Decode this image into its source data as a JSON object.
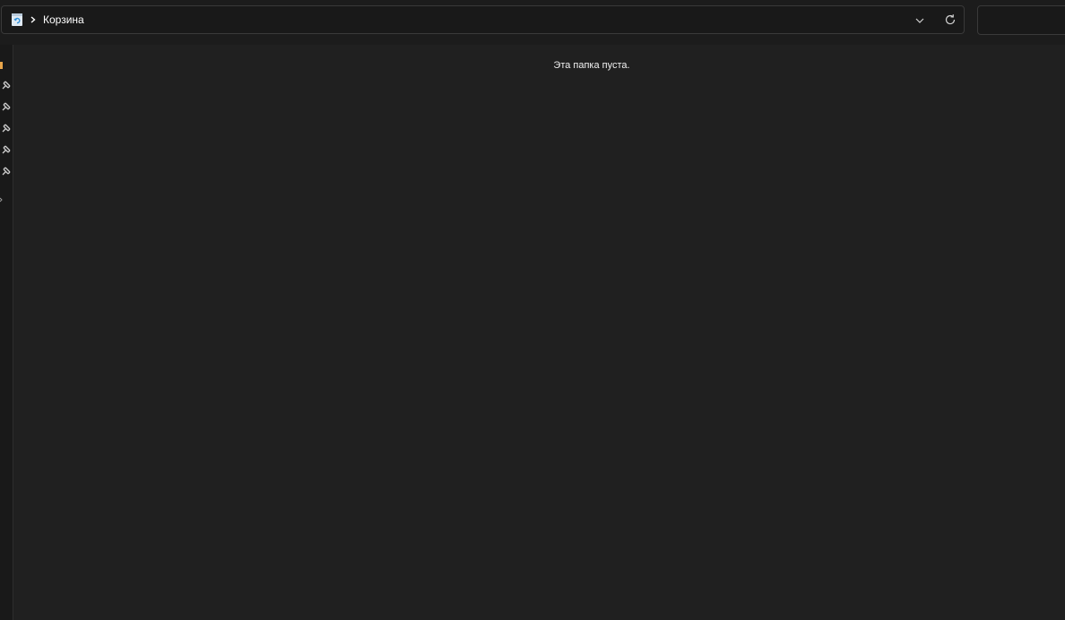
{
  "address_bar": {
    "location_icon": "recycle-bin-icon",
    "separator_icon": "chevron-right-icon",
    "location_label": "Корзина",
    "dropdown_icon": "chevron-down-icon",
    "refresh_icon": "refresh-icon"
  },
  "search": {
    "placeholder": ""
  },
  "nav_pane": {
    "items": [
      {
        "icon": "folder-icon",
        "color": "#e8a54a"
      },
      {
        "icon": "pin-icon"
      },
      {
        "icon": "pin-icon"
      },
      {
        "icon": "pin-icon"
      },
      {
        "icon": "pin-icon"
      },
      {
        "icon": "pin-icon"
      },
      {
        "icon": "expand-chevron-icon"
      }
    ]
  },
  "content": {
    "empty_message": "Эта папка пуста."
  },
  "colors": {
    "background": "#202020",
    "toolbar": "#1c1c1c",
    "border": "#3a3a3a",
    "accent": "#4fa8e0"
  }
}
